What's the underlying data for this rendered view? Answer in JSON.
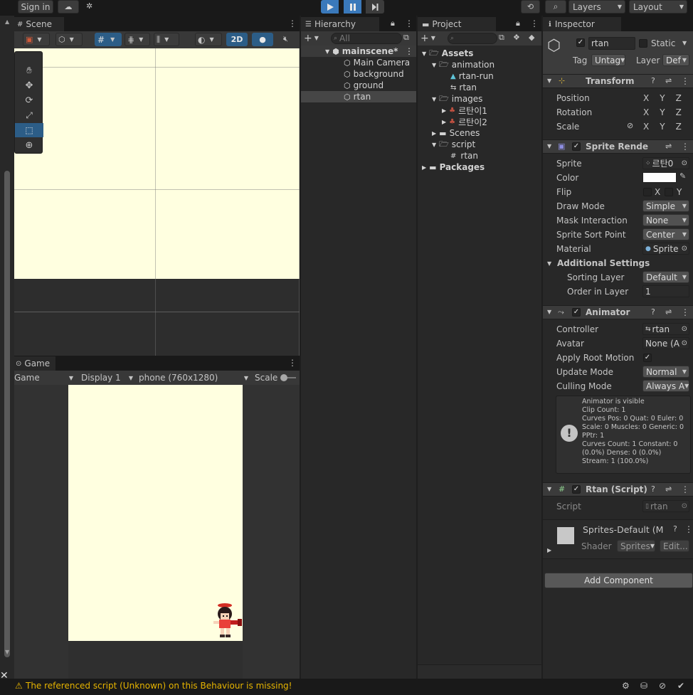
{
  "toolbar": {
    "sign_in": "Sign in",
    "layers": "Layers",
    "layout": "Layout"
  },
  "scene": {
    "tab": "Scene",
    "mode_2d": "2D"
  },
  "game": {
    "tab": "Game",
    "view_select": "Game",
    "display": "Display 1",
    "resolution": "phone (760x1280)",
    "scale": "Scale"
  },
  "hierarchy": {
    "tab": "Hierarchy",
    "search_placeholder": "All",
    "scene_name": "mainscene*",
    "items": [
      "Main Camera",
      "background",
      "ground",
      "rtan"
    ]
  },
  "project": {
    "tab": "Project",
    "assets": "Assets",
    "animation": "animation",
    "anim_run": "rtan-run",
    "anim_ctrl": "rtan",
    "images": "images",
    "img1": "르탄이1",
    "img2": "르탄이2",
    "scenes": "Scenes",
    "script": "script",
    "script_file": "rtan",
    "packages": "Packages"
  },
  "inspector": {
    "tab": "Inspector",
    "object_name": "rtan",
    "static_label": "Static",
    "tag_label": "Tag",
    "tag_value": "Untag",
    "layer_label": "Layer",
    "layer_value": "Def",
    "transform": {
      "title": "Transform",
      "position": "Position",
      "rotation": "Rotation",
      "scale": "Scale",
      "x": "X",
      "y": "Y",
      "z": "Z"
    },
    "sprite_renderer": {
      "title": "Sprite Rendere",
      "sprite_label": "Sprite",
      "sprite_value": "르탄0",
      "color_label": "Color",
      "flip_label": "Flip",
      "flip_x": "X",
      "flip_y": "Y",
      "draw_mode_label": "Draw Mode",
      "draw_mode_value": "Simple",
      "mask_label": "Mask Interaction",
      "mask_value": "None",
      "sort_point_label": "Sprite Sort Point",
      "sort_point_value": "Center",
      "material_label": "Material",
      "material_value": "Sprite",
      "additional": "Additional Settings",
      "sorting_layer_label": "Sorting Layer",
      "sorting_layer_value": "Default",
      "order_label": "Order in Layer",
      "order_value": "1"
    },
    "animator": {
      "title": "Animator",
      "controller_label": "Controller",
      "controller_value": "rtan",
      "avatar_label": "Avatar",
      "avatar_value": "None (A",
      "root_motion_label": "Apply Root Motion",
      "update_mode_label": "Update Mode",
      "update_mode_value": "Normal",
      "culling_label": "Culling Mode",
      "culling_value": "Always A",
      "info": [
        "Animator is visible",
        "Clip Count: 1",
        "Curves Pos: 0 Quat: 0 Euler: 0",
        "Scale: 0 Muscles: 0 Generic: 0",
        "PPtr: 1",
        "Curves Count: 1 Constant: 0",
        "(0.0%) Dense: 0 (0.0%)",
        "Stream: 1 (100.0%)"
      ]
    },
    "script_comp": {
      "title": "Rtan (Script)",
      "script_label": "Script",
      "script_value": "rtan"
    },
    "material_comp": {
      "title": "Sprites-Default (M",
      "shader_label": "Shader",
      "shader_value": "Sprites",
      "edit": "Edit..."
    },
    "add_component": "Add Component"
  },
  "status": {
    "message": "The referenced script (Unknown) on this Behaviour is missing!"
  },
  "colors": {
    "accent": "#2c5d87",
    "play_blue": "#3a79bb",
    "scene_bg": "#ffffe0",
    "warning": "#e6b400"
  }
}
